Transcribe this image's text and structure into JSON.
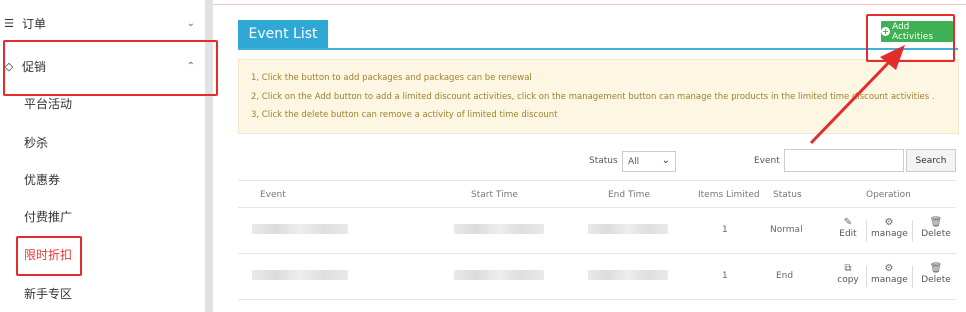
{
  "sidebar": {
    "menus": [
      {
        "icon": "order-icon",
        "label": "订单"
      },
      {
        "icon": "tag-icon",
        "label": "促销"
      }
    ],
    "sub_items": [
      "平台活动",
      "秒杀",
      "优惠券",
      "付费推广",
      "限时折扣",
      "新手专区"
    ],
    "active_item": "限时折扣"
  },
  "main": {
    "tab_label": "Event List",
    "add_button": "Add Activities",
    "notice": [
      "1, Click the button to add packages and packages can be renewal",
      "2, Click on the Add button to add a limited discount activities, click on the management button can manage the products in the limited time discount activities .",
      "3, Click the delete button can remove a activity of limited time discount"
    ],
    "filters": {
      "status_label": "Status",
      "status_value": "All",
      "event_label": "Event",
      "event_value": "",
      "search_button": "Search"
    },
    "table": {
      "headers": [
        "Event",
        "Start Time",
        "End Time",
        "Items Limited",
        "Status",
        "Operation"
      ],
      "rows": [
        {
          "items_limited": "1",
          "status": "Normal",
          "ops": [
            "Edit",
            "manage",
            "Delete"
          ]
        },
        {
          "items_limited": "1",
          "status": "End",
          "ops": [
            "copy",
            "manage",
            "Delete"
          ]
        }
      ]
    }
  },
  "colors": {
    "accent_blue": "#2fa8d6",
    "add_green": "#3fb054",
    "annotation_red": "#e32d2d",
    "active_red": "#e53935"
  }
}
